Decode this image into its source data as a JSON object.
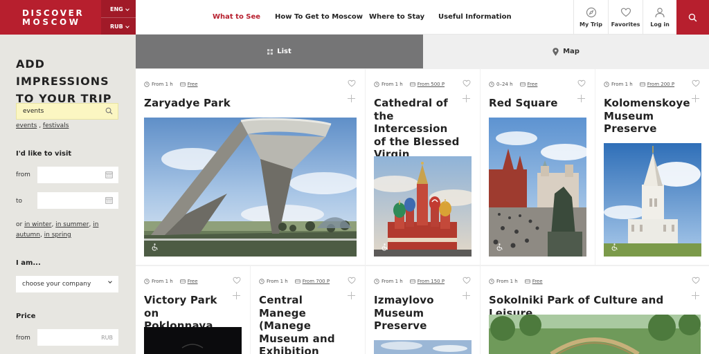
{
  "header": {
    "brand_line1": "DISCOVER",
    "brand_line2": "MOSCOW",
    "language": "ENG",
    "currency": "RUB",
    "nav": [
      {
        "label": "What to See",
        "active": true
      },
      {
        "label": "How To Get to Moscow",
        "active": false
      },
      {
        "label": "Where to Stay",
        "active": false
      },
      {
        "label": "Useful Information",
        "active": false
      }
    ],
    "my_trip": "My Trip",
    "favorites": "Favorites",
    "log_in": "Log in",
    "brand_color": "#b71f2e"
  },
  "sidebar": {
    "title_line1": "ADD  IMPRESSIONS",
    "title_line2": "TO YOUR TRIP",
    "search_value": "events",
    "tag1": "events",
    "tag_sep": " , ",
    "tag2": "festivals",
    "visit_label": "I'd like to visit",
    "from_label": "from",
    "to_label": "to",
    "seasons_or": "or ",
    "season_winter": "in winter",
    "season_summer": "in summer",
    "season_autumn": "autumn",
    "season_spring": "in spring",
    "season_in": "in",
    "i_am_label": "I am...",
    "company_placeholder": "choose your company",
    "price_label": "Price",
    "price_from_label": "from",
    "price_currency": "RUB"
  },
  "view_toggle": {
    "list": "List",
    "map": "Map"
  },
  "cards": [
    {
      "duration": "From 1 h",
      "price": "Free",
      "title": "Zaryadye Park"
    },
    {
      "duration": "From 1 h",
      "price": "From 500 P",
      "title": "Cathedral of the Intercession of the Blessed Virgin"
    },
    {
      "duration": "0–24 h",
      "price": "Free",
      "title": "Red Square"
    },
    {
      "duration": "From 1 h",
      "price": "From 200 P",
      "title": "Kolomenskoye Museum Preserve"
    },
    {
      "duration": "From 1 h",
      "price": "Free",
      "title": "Victory Park on Poklonnaya Hill"
    },
    {
      "duration": "From 1 h",
      "price": "From 700 P",
      "title": "Central Manege (Manege Museum and Exhibition Association)"
    },
    {
      "duration": "From 1 h",
      "price": "From 150 P",
      "title": "Izmaylovo Museum Preserve"
    },
    {
      "duration": "From 1 h",
      "price": "Free",
      "title": "Sokolniki Park of Culture and Leisure"
    }
  ]
}
